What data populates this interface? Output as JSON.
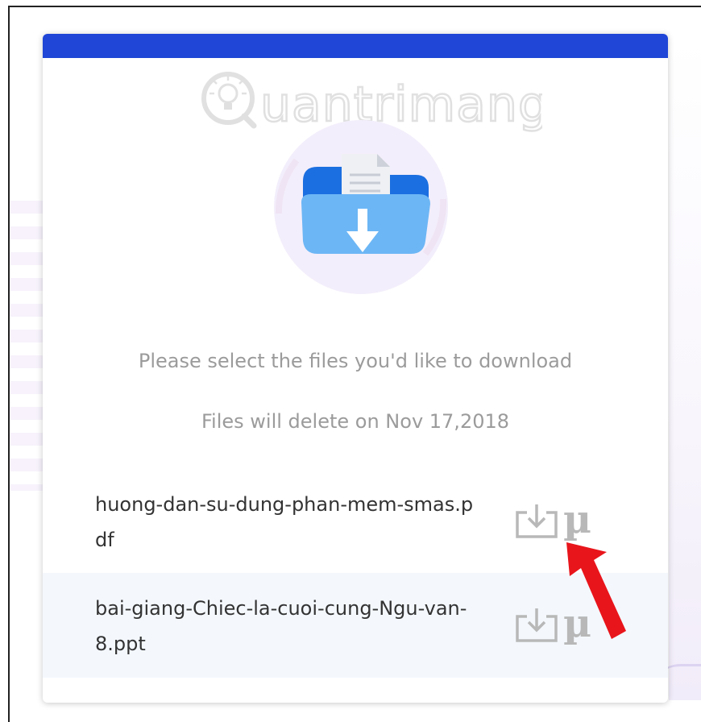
{
  "card": {
    "accent_color": "#1f46d6",
    "watermark": "uantrimang",
    "hero_icon": "folder-download-icon"
  },
  "messages": {
    "select_prompt": "Please select the files you'd like to download",
    "delete_notice": "Files will delete on Nov 17,2018"
  },
  "files": [
    {
      "name": "huong-dan-su-dung-phan-mem-smas.pdf",
      "download_icon": "download-icon",
      "utorrent_icon": "utorrent-icon",
      "utorrent_glyph": "µ"
    },
    {
      "name": "bai-giang-Chiec-la-cuoi-cung-Ngu-van-8.ppt",
      "download_icon": "download-icon",
      "utorrent_icon": "utorrent-icon",
      "utorrent_glyph": "µ"
    }
  ],
  "annotation": {
    "color": "#e8151b",
    "icon": "red-arrow-annotation"
  }
}
